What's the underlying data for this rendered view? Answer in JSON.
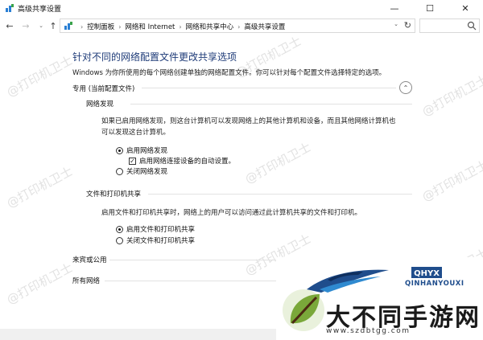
{
  "window": {
    "title": "高级共享设置"
  },
  "titlebar": {
    "minimize": "—",
    "maximize": "☐",
    "close": "✕"
  },
  "nav": {
    "back": "←",
    "forward": "→",
    "recent": "⌄",
    "up": "↑",
    "breadcrumbs": [
      "控制面板",
      "网络和 Internet",
      "网络和共享中心",
      "高级共享设置"
    ],
    "separator": "›",
    "address_dropdown": "⌄",
    "refresh": "↻",
    "search_placeholder": ""
  },
  "main": {
    "heading": "针对不同的网络配置文件更改共享选项",
    "description": "Windows 为你所使用的每个网络创建单独的网络配置文件。你可以针对每个配置文件选择特定的选项。",
    "private_profile": {
      "title": "专用 (当前配置文件)",
      "collapse": "⌃",
      "network_discovery": {
        "title": "网络发现",
        "text_line1": "如果已启用网络发现，则这台计算机可以发现网络上的其他计算机和设备，而且其他网络计算机也",
        "text_line2": "可以发现这台计算机。",
        "on_label": "启用网络发现",
        "auto_setup_label": "启用网络连接设备的自动设置。",
        "off_label": "关闭网络发现"
      },
      "file_printer_sharing": {
        "title": "文件和打印机共享",
        "text": "启用文件和打印机共享时，网络上的用户可以访问通过此计算机共享的文件和打印机。",
        "on_label": "启用文件和打印机共享",
        "off_label": "关闭文件和打印机共享"
      }
    },
    "guest_public": {
      "title": "来宾或公用"
    },
    "all_networks": {
      "title": "所有网络"
    }
  },
  "watermarks": {
    "text": "@打印机卫士"
  },
  "overlay": {
    "brand_small": "QINHANYOUXI",
    "brand_mark": "QHYX",
    "brand_big": "大不同手游网",
    "url": "www.szdbtgg.com"
  },
  "colors": {
    "heading": "#1e3b78",
    "brand_blue": "#1f4d8c",
    "leaf_green": "#7aa83a",
    "leaf_dark": "#4b2a12"
  }
}
